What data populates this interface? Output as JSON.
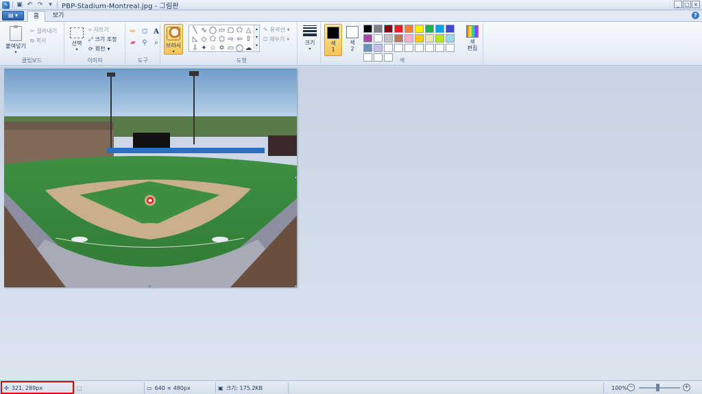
{
  "titlebar": {
    "title": "PBP-Stadium-Montreal.jpg - 그림판",
    "qat_icons": [
      "paint-icon",
      "save-icon",
      "undo-icon",
      "redo-icon",
      "customize-icon"
    ],
    "win_min": "_",
    "win_max": "□",
    "win_close": "×"
  },
  "tabs": {
    "app_menu": "▤ ▾",
    "home": "홈",
    "view": "보기",
    "help": "?"
  },
  "ribbon": {
    "clipboard": {
      "label": "클립보드",
      "paste": "붙여넣기",
      "cut": "잘라내기",
      "copy": "복사"
    },
    "image": {
      "label": "이미지",
      "select": "선택",
      "crop": "자르기",
      "resize": "크기 조정",
      "rotate": "회전"
    },
    "tools": {
      "label": "도구"
    },
    "brushes": {
      "label": "브러시"
    },
    "shapes": {
      "label": "도형",
      "outline": "윤곽선",
      "fill": "채우기"
    },
    "size": {
      "label": "크기"
    },
    "colors": {
      "label": "색",
      "color1": "색\n1",
      "color1_value": "#000000",
      "color2": "색\n2",
      "color2_value": "#ffffff",
      "edit": "색\n편집",
      "palette": [
        "#000000",
        "#7f7f7f",
        "#880015",
        "#ed1c24",
        "#ff7f27",
        "#fff200",
        "#22b14c",
        "#00a2e8",
        "#3f48cc",
        "#a349a4",
        "#ffffff",
        "#c3c3c3",
        "#b97a57",
        "#ffaec9",
        "#ffc90e",
        "#efe4b0",
        "#b5e61d",
        "#99d9ea",
        "#7092be",
        "#c8bfe7",
        "#ffffff",
        "#ffffff",
        "#ffffff",
        "#ffffff",
        "#ffffff",
        "#ffffff",
        "#ffffff",
        "#ffffff",
        "#ffffff",
        "#ffffff"
      ]
    }
  },
  "statusbar": {
    "cursor_pos": "321, 289px",
    "selection_size": "",
    "image_size": "640 × 480px",
    "file_size": "크기: 175.2KB",
    "zoom": "100%"
  }
}
